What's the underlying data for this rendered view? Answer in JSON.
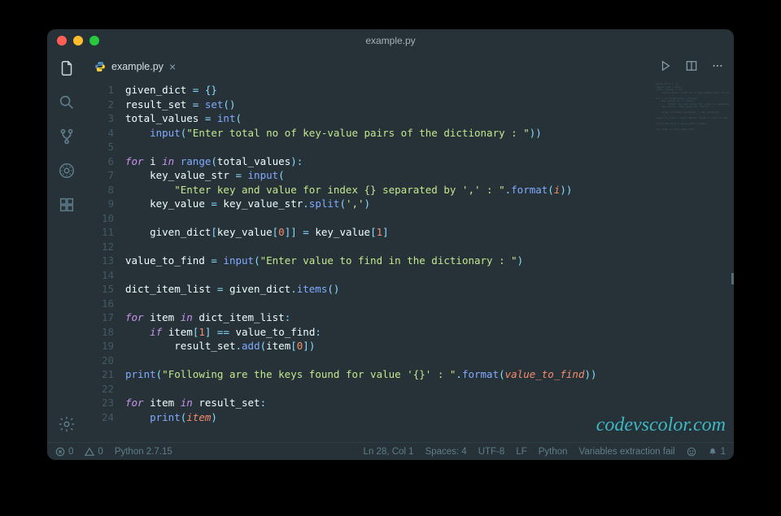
{
  "title": "example.py",
  "tab": {
    "label": "example.py",
    "icon": "python-icon"
  },
  "watermark": "codevscolor.com",
  "statusbar": {
    "errors": "0",
    "warnings": "0",
    "python_version": "Python 2.7.15",
    "cursor": "Ln 28, Col 1",
    "spaces": "Spaces: 4",
    "encoding": "UTF-8",
    "eol": "LF",
    "language": "Python",
    "analysis": "Variables extraction fail",
    "bell": "1"
  },
  "code": [
    {
      "n": 1,
      "t": [
        [
          "id",
          "given_dict"
        ],
        [
          "op",
          " = {}"
        ]
      ]
    },
    {
      "n": 2,
      "t": [
        [
          "id",
          "result_set"
        ],
        [
          "op",
          " = "
        ],
        [
          "fn",
          "set"
        ],
        [
          "op",
          "()"
        ]
      ]
    },
    {
      "n": 3,
      "t": [
        [
          "id",
          "total_values"
        ],
        [
          "op",
          " = "
        ],
        [
          "fn",
          "int"
        ],
        [
          "op",
          "("
        ]
      ]
    },
    {
      "n": 4,
      "indent": 1,
      "t": [
        [
          "fn",
          "input"
        ],
        [
          "op",
          "("
        ],
        [
          "str",
          "\"Enter total no of key-value pairs of the dictionary : \""
        ],
        [
          "op",
          "))"
        ]
      ]
    },
    {
      "n": 5,
      "t": []
    },
    {
      "n": 6,
      "t": [
        [
          "kw",
          "for"
        ],
        [
          "id",
          " i "
        ],
        [
          "kw",
          "in"
        ],
        [
          "op",
          " "
        ],
        [
          "fn",
          "range"
        ],
        [
          "op",
          "("
        ],
        [
          "id",
          "total_values"
        ],
        [
          "op",
          "):"
        ]
      ]
    },
    {
      "n": 7,
      "indent": 1,
      "t": [
        [
          "id",
          "key_value_str"
        ],
        [
          "op",
          " = "
        ],
        [
          "fn",
          "input"
        ],
        [
          "op",
          "("
        ]
      ]
    },
    {
      "n": 8,
      "indent": 2,
      "t": [
        [
          "str",
          "\"Enter key and value for index {} separated by ',' : \""
        ],
        [
          "op",
          "."
        ],
        [
          "fn",
          "format"
        ],
        [
          "op",
          "("
        ],
        [
          "param",
          "i"
        ],
        [
          "op",
          "))"
        ]
      ]
    },
    {
      "n": 9,
      "indent": 1,
      "t": [
        [
          "id",
          "key_value"
        ],
        [
          "op",
          " = "
        ],
        [
          "id",
          "key_value_str"
        ],
        [
          "op",
          "."
        ],
        [
          "fn",
          "split"
        ],
        [
          "op",
          "("
        ],
        [
          "str",
          "','"
        ],
        [
          "op",
          ")"
        ]
      ]
    },
    {
      "n": 10,
      "t": []
    },
    {
      "n": 11,
      "indent": 1,
      "t": [
        [
          "id",
          "given_dict"
        ],
        [
          "op",
          "["
        ],
        [
          "id",
          "key_value"
        ],
        [
          "op",
          "["
        ],
        [
          "num",
          "0"
        ],
        [
          "op",
          "]] = "
        ],
        [
          "id",
          "key_value"
        ],
        [
          "op",
          "["
        ],
        [
          "num",
          "1"
        ],
        [
          "op",
          "]"
        ]
      ]
    },
    {
      "n": 12,
      "t": []
    },
    {
      "n": 13,
      "t": [
        [
          "id",
          "value_to_find"
        ],
        [
          "op",
          " = "
        ],
        [
          "fn",
          "input"
        ],
        [
          "op",
          "("
        ],
        [
          "str",
          "\"Enter value to find in the dictionary : \""
        ],
        [
          "op",
          ")"
        ]
      ]
    },
    {
      "n": 14,
      "t": []
    },
    {
      "n": 15,
      "t": [
        [
          "id",
          "dict_item_list"
        ],
        [
          "op",
          " = "
        ],
        [
          "id",
          "given_dict"
        ],
        [
          "op",
          "."
        ],
        [
          "fn",
          "items"
        ],
        [
          "op",
          "()"
        ]
      ]
    },
    {
      "n": 16,
      "t": []
    },
    {
      "n": 17,
      "t": [
        [
          "kw",
          "for"
        ],
        [
          "id",
          " item "
        ],
        [
          "kw",
          "in"
        ],
        [
          "id",
          " dict_item_list"
        ],
        [
          "op",
          ":"
        ]
      ]
    },
    {
      "n": 18,
      "indent": 1,
      "t": [
        [
          "kw",
          "if"
        ],
        [
          "id",
          " item"
        ],
        [
          "op",
          "["
        ],
        [
          "num",
          "1"
        ],
        [
          "op",
          "] == "
        ],
        [
          "id",
          "value_to_find"
        ],
        [
          "op",
          ":"
        ]
      ]
    },
    {
      "n": 19,
      "indent": 2,
      "t": [
        [
          "id",
          "result_set"
        ],
        [
          "op",
          "."
        ],
        [
          "fn",
          "add"
        ],
        [
          "op",
          "("
        ],
        [
          "id",
          "item"
        ],
        [
          "op",
          "["
        ],
        [
          "num",
          "0"
        ],
        [
          "op",
          "])"
        ]
      ]
    },
    {
      "n": 20,
      "t": []
    },
    {
      "n": 21,
      "t": [
        [
          "fn",
          "print"
        ],
        [
          "op",
          "("
        ],
        [
          "str",
          "\"Following are the keys found for value '{}' : \""
        ],
        [
          "op",
          "."
        ],
        [
          "fn",
          "format"
        ],
        [
          "op",
          "("
        ],
        [
          "param",
          "value_to_find"
        ],
        [
          "op",
          "))"
        ]
      ]
    },
    {
      "n": 22,
      "t": []
    },
    {
      "n": 23,
      "t": [
        [
          "kw",
          "for"
        ],
        [
          "id",
          " item "
        ],
        [
          "kw",
          "in"
        ],
        [
          "id",
          " result_set"
        ],
        [
          "op",
          ":"
        ]
      ]
    },
    {
      "n": 24,
      "indent": 1,
      "t": [
        [
          "fn",
          "print"
        ],
        [
          "op",
          "("
        ],
        [
          "param",
          "item"
        ],
        [
          "op",
          ")"
        ]
      ]
    }
  ]
}
